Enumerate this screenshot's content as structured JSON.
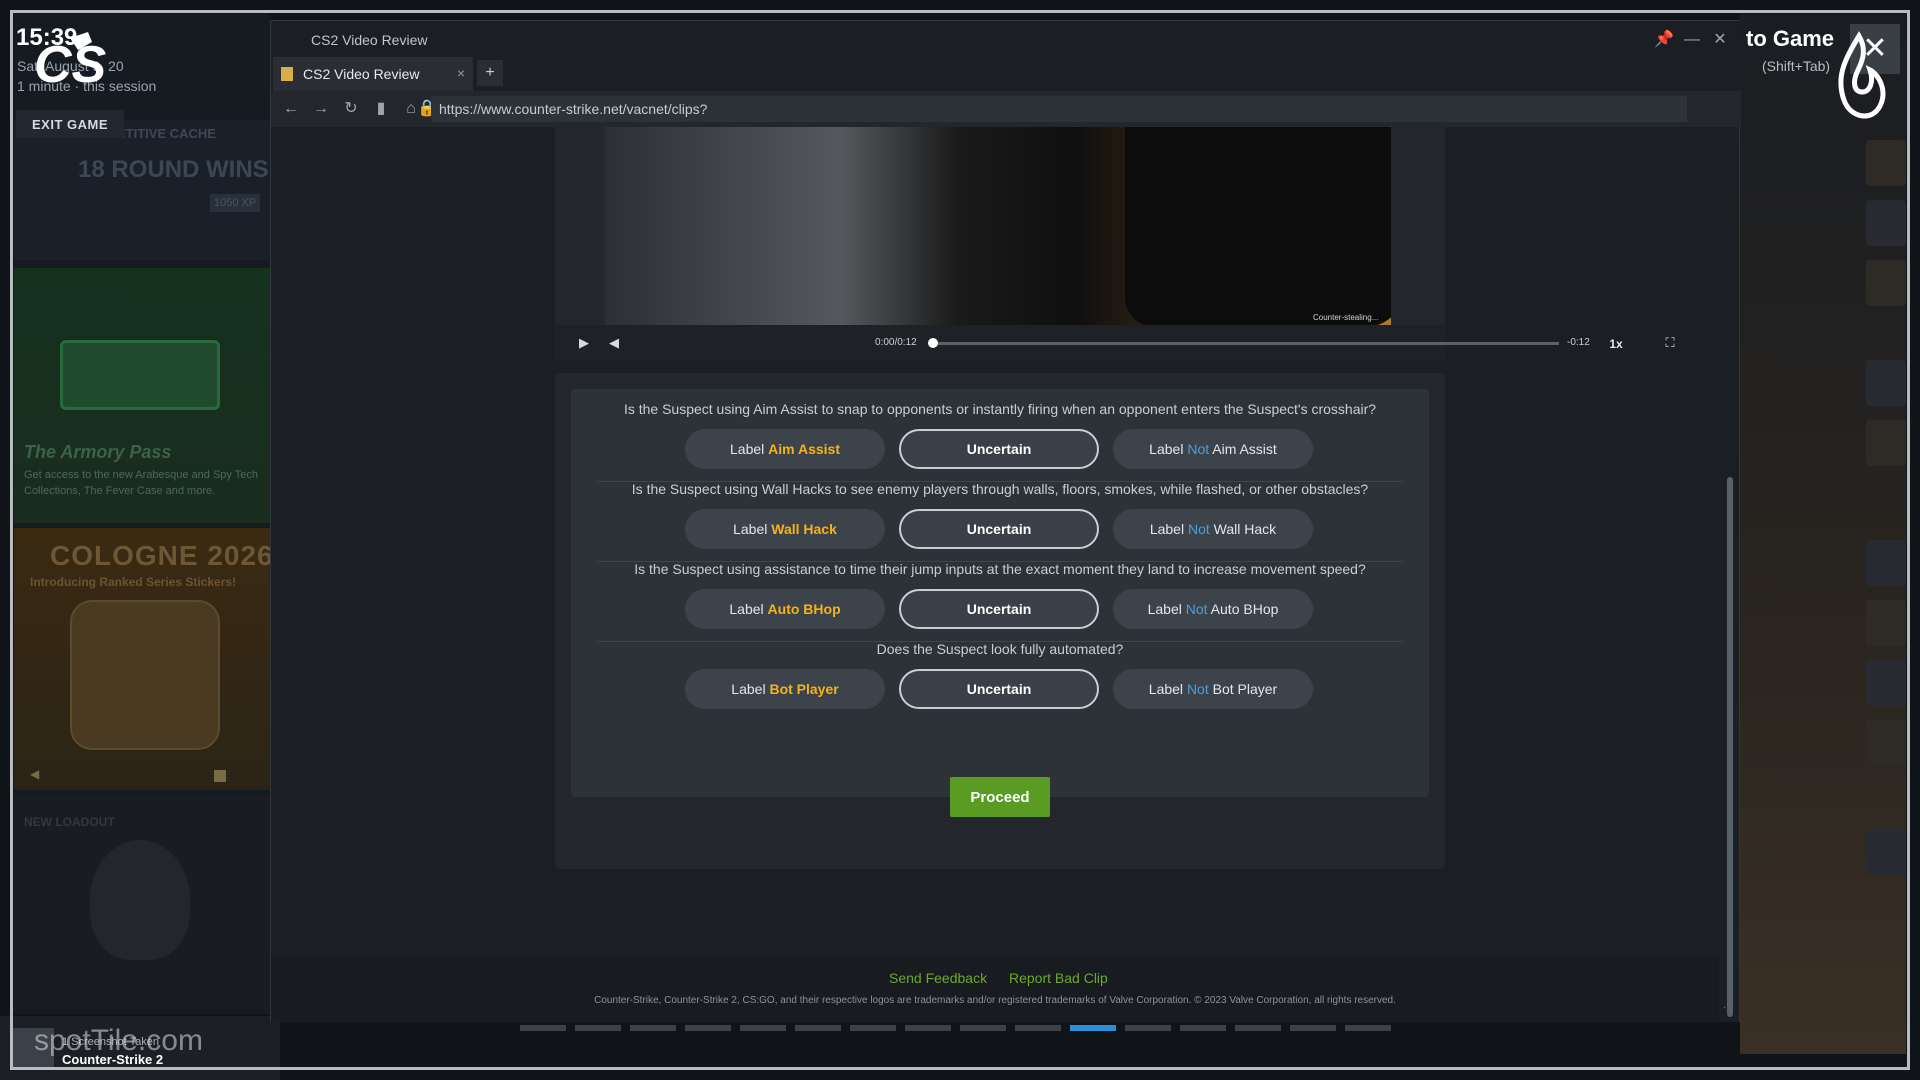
{
  "background": {
    "clock": "15:39",
    "date": "Sat, August 9, 20",
    "session": "1 minute · this session",
    "exit_game_label": "EXIT GAME",
    "stats": {
      "mode": "COMPETITIVE  CACHE",
      "rounds": "18 ROUND WINS",
      "score": "1050 XP"
    },
    "armory": {
      "title": "The Armory Pass",
      "description": "Get access to the new Arabesque and Spy Tech Collections, The Fever Case and more."
    },
    "cologne": {
      "title": "COLOGNE 2026",
      "subtitle": "Introducing Ranked Series Stickers!"
    },
    "new_label": "NEW LOADOUT",
    "to_game": "to Game",
    "to_game_hint": "(Shift+Tab)",
    "close_overlay_glyph": "✕",
    "toast": {
      "line1": "1 Screenshot Taken",
      "line2": "Counter-Strike 2"
    },
    "watermark": "spotTile.com"
  },
  "browser": {
    "window_title": "CS2 Video Review",
    "tab_title": "CS2 Video Review",
    "tab_close": "×",
    "new_tab": "+",
    "url": "https://www.counter-strike.net/vacnet/clips?",
    "controls": {
      "pin": "📌",
      "minimize": "—",
      "close": "✕"
    }
  },
  "video": {
    "caption": "Counter-stealing...",
    "time": "0:00/0:12",
    "remaining": "-0:12",
    "speed": "1x",
    "progress": 0.0
  },
  "questions": [
    {
      "text": "Is the Suspect using Aim Assist to snap to opponents or instantly firing when an opponent enters the Suspect's crosshair?",
      "yes_prefix": "Label ",
      "yes_label": "Aim Assist",
      "uncertain": "Uncertain",
      "no_prefix": "Label ",
      "no_not": "Not",
      "no_label": " Aim Assist"
    },
    {
      "text": "Is the Suspect using Wall Hacks to see enemy players through walls, floors, smokes, while flashed, or other obstacles?",
      "yes_prefix": "Label ",
      "yes_label": "Wall Hack",
      "uncertain": "Uncertain",
      "no_prefix": "Label ",
      "no_not": "Not",
      "no_label": " Wall Hack"
    },
    {
      "text": "Is the Suspect using assistance to time their jump inputs at the exact moment they land to increase movement speed?",
      "yes_prefix": "Label ",
      "yes_label": "Auto BHop",
      "uncertain": "Uncertain",
      "no_prefix": "Label ",
      "no_not": "Not",
      "no_label": " Auto BHop"
    },
    {
      "text": "Does the Suspect look fully automated?",
      "yes_prefix": "Label ",
      "yes_label": "Bot Player",
      "uncertain": "Uncertain",
      "no_prefix": "Label ",
      "no_not": "Not",
      "no_label": " Bot Player"
    }
  ],
  "proceed_label": "Proceed",
  "footer": {
    "send_feedback": "Send Feedback",
    "report_bad_clip": "Report Bad Clip",
    "copyright": "Counter-Strike, Counter-Strike 2, CS:GO, and their respective logos are trademarks and/or registered trademarks of Valve Corporation. © 2023 Valve Corporation, all rights reserved."
  },
  "pagination": {
    "count": 16,
    "active_index": 10
  },
  "colors": {
    "accent_yes": "#f5b21b",
    "accent_not": "#4a9fd8",
    "proceed_green": "#5a9b23",
    "link_green": "#6aaa2e",
    "active_dot": "#2a8fd8"
  }
}
